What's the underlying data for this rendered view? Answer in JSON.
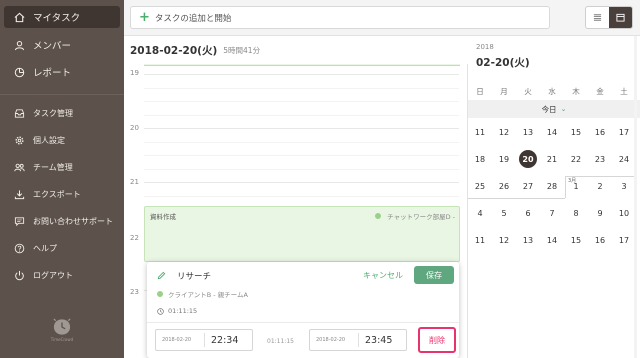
{
  "sidebar": {
    "main_items": [
      {
        "label": "マイタスク",
        "icon": "home-icon"
      },
      {
        "label": "メンバー",
        "icon": "user-icon"
      },
      {
        "label": "レポート",
        "icon": "report-icon"
      }
    ],
    "items": [
      {
        "label": "タスク管理",
        "icon": "inbox-icon"
      },
      {
        "label": "個人設定",
        "icon": "gear-icon"
      },
      {
        "label": "チーム管理",
        "icon": "team-icon"
      },
      {
        "label": "エクスポート",
        "icon": "download-icon"
      },
      {
        "label": "お問い合わせサポート",
        "icon": "chat-icon"
      },
      {
        "label": "ヘルプ",
        "icon": "help-icon"
      },
      {
        "label": "ログアウト",
        "icon": "power-icon"
      }
    ],
    "logo_text": "TimeCrowd"
  },
  "topbar": {
    "add_task_label": "タスクの追加と開始",
    "view_icons": [
      "list-icon",
      "calendar-icon"
    ]
  },
  "day": {
    "date": "2018-02-20(火)",
    "duration": "5時間41分",
    "hours": [
      "19",
      "20",
      "21",
      "22",
      "23"
    ]
  },
  "event": {
    "title": "資料作成",
    "project": "チャットワーク部屋D -"
  },
  "editor": {
    "task_name": "リサーチ",
    "cancel_label": "キャンセル",
    "save_label": "保存",
    "project": "クライアントB - 親チームA",
    "duration": "01:11:15",
    "start_date": "2018-02-20",
    "start_time": "22:34",
    "elapsed": "01:11:15",
    "end_date": "2018-02-20",
    "end_time": "23:45",
    "delete_label": "削除"
  },
  "calendar": {
    "year": "2018",
    "selected_label": "02-20(火)",
    "weekdays": [
      "日",
      "月",
      "火",
      "水",
      "木",
      "金",
      "土"
    ],
    "today_label": "今日",
    "month_marker": "3月",
    "weeks": [
      [
        "11",
        "12",
        "13",
        "14",
        "15",
        "16",
        "17"
      ],
      [
        "18",
        "19",
        "20",
        "21",
        "22",
        "23",
        "24"
      ],
      [
        "25",
        "26",
        "27",
        "28",
        "1",
        "2",
        "3"
      ],
      [
        "4",
        "5",
        "6",
        "7",
        "8",
        "9",
        "10"
      ],
      [
        "11",
        "12",
        "13",
        "14",
        "15",
        "16",
        "17"
      ]
    ],
    "selected_day": "20"
  },
  "colors": {
    "sidebar_bg": "#5c514b",
    "accent_green": "#4cae6b",
    "save_green": "#5fa87f",
    "event_bg": "#eaf6e4",
    "highlight_pink": "#e8336c"
  }
}
